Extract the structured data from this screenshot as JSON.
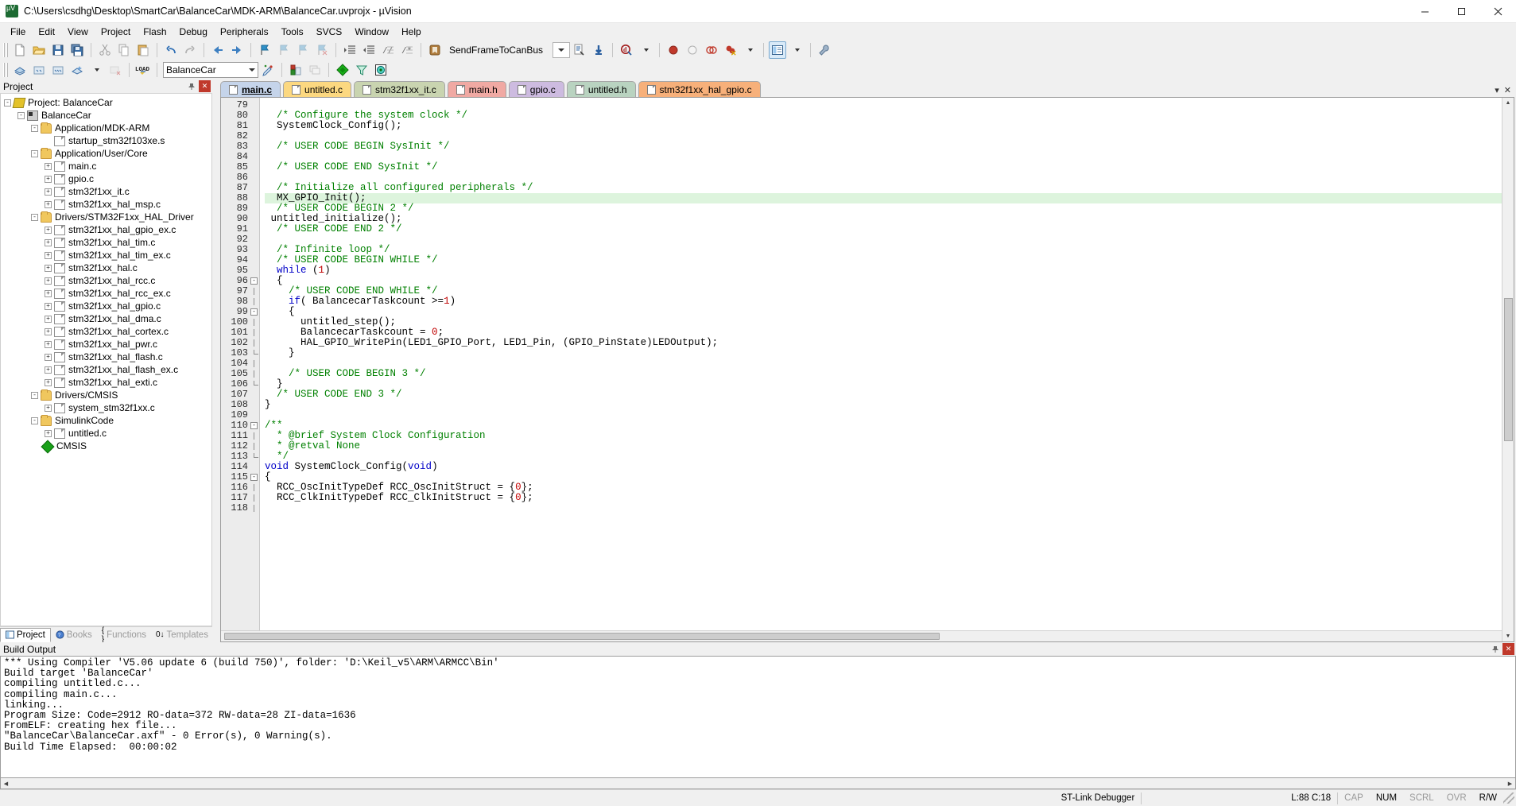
{
  "window": {
    "title": "C:\\Users\\csdhg\\Desktop\\SmartCar\\BalanceCar\\MDK-ARM\\BalanceCar.uvprojx - µVision",
    "app_icon": "uvision-icon",
    "minimize": "─",
    "maximize": "☐",
    "close": "✕"
  },
  "menu": {
    "items": [
      {
        "label": "File"
      },
      {
        "label": "Edit"
      },
      {
        "label": "View"
      },
      {
        "label": "Project"
      },
      {
        "label": "Flash"
      },
      {
        "label": "Debug"
      },
      {
        "label": "Peripherals"
      },
      {
        "label": "Tools"
      },
      {
        "label": "SVCS"
      },
      {
        "label": "Window"
      },
      {
        "label": "Help"
      }
    ]
  },
  "toolbar1": {
    "icons": [
      "new-file-icon",
      "open-file-icon",
      "save-icon",
      "save-all-icon",
      "cut-icon",
      "copy-icon",
      "paste-icon",
      "undo-icon",
      "redo-icon",
      "navigate-back-icon",
      "navigate-forward-icon",
      "bookmark-toggle-icon",
      "bookmark-prev-icon",
      "bookmark-next-icon",
      "bookmark-clear-icon",
      "indent-icon",
      "outdent-icon",
      "comment-icon",
      "uncomment-icon"
    ],
    "bookmark_label": "SendFrameToCanBus",
    "combo_icon": "chevron-down-icon",
    "insert_bookmark_icon": "insert-bookmark-icon",
    "find-in-files-icon": "find-in-files-icon",
    "debug_icon": "start-debug-icon",
    "breakpoint_icon": "insert-breakpoint-icon",
    "breakpoint_disable_icon": "disable-breakpoint-icon",
    "breakpoint_kill_all_icon": "kill-all-breakpoints-icon",
    "breakpoint_disable_all_icon": "disable-all-breakpoints-icon",
    "window_manager_icon": "manage-windows-icon",
    "configure_icon": "configure-tools-icon"
  },
  "toolbar2": {
    "icons": [
      "translate-icon",
      "build-icon",
      "rebuild-icon",
      "batch-build-icon",
      "stop-build-icon",
      "load-icon"
    ],
    "load_label": "LOAD",
    "target_label": "BalanceCar",
    "target_dropdown_icon": "chevron-down-icon",
    "options_icon": "options-for-target-icon",
    "manage_icon": "manage-project-items-icon",
    "book_icon": "books-icon",
    "component_icon": "manage-run-time-environment-icon",
    "filter_icon": "filter-icon",
    "pack_icon": "pack-installer-icon"
  },
  "project_pane": {
    "title": "Project",
    "pin_icon": "pin-icon",
    "close_icon": "close-icon",
    "tree": [
      {
        "depth": 0,
        "toggle": "-",
        "icon": "project-icon",
        "label": "Project: BalanceCar"
      },
      {
        "depth": 1,
        "toggle": "-",
        "icon": "target-icon",
        "label": "BalanceCar"
      },
      {
        "depth": 2,
        "toggle": "-",
        "icon": "folder-icon",
        "label": "Application/MDK-ARM"
      },
      {
        "depth": 3,
        "toggle": "",
        "icon": "file-icon",
        "label": "startup_stm32f103xe.s"
      },
      {
        "depth": 2,
        "toggle": "-",
        "icon": "folder-icon",
        "label": "Application/User/Core"
      },
      {
        "depth": 3,
        "toggle": "+",
        "icon": "file-icon",
        "label": "main.c"
      },
      {
        "depth": 3,
        "toggle": "+",
        "icon": "file-icon",
        "label": "gpio.c"
      },
      {
        "depth": 3,
        "toggle": "+",
        "icon": "file-icon",
        "label": "stm32f1xx_it.c"
      },
      {
        "depth": 3,
        "toggle": "+",
        "icon": "file-icon",
        "label": "stm32f1xx_hal_msp.c"
      },
      {
        "depth": 2,
        "toggle": "-",
        "icon": "folder-icon",
        "label": "Drivers/STM32F1xx_HAL_Driver"
      },
      {
        "depth": 3,
        "toggle": "+",
        "icon": "file-icon",
        "label": "stm32f1xx_hal_gpio_ex.c"
      },
      {
        "depth": 3,
        "toggle": "+",
        "icon": "file-icon",
        "label": "stm32f1xx_hal_tim.c"
      },
      {
        "depth": 3,
        "toggle": "+",
        "icon": "file-icon",
        "label": "stm32f1xx_hal_tim_ex.c"
      },
      {
        "depth": 3,
        "toggle": "+",
        "icon": "file-icon",
        "label": "stm32f1xx_hal.c"
      },
      {
        "depth": 3,
        "toggle": "+",
        "icon": "file-icon",
        "label": "stm32f1xx_hal_rcc.c"
      },
      {
        "depth": 3,
        "toggle": "+",
        "icon": "file-icon",
        "label": "stm32f1xx_hal_rcc_ex.c"
      },
      {
        "depth": 3,
        "toggle": "+",
        "icon": "file-icon",
        "label": "stm32f1xx_hal_gpio.c"
      },
      {
        "depth": 3,
        "toggle": "+",
        "icon": "file-icon",
        "label": "stm32f1xx_hal_dma.c"
      },
      {
        "depth": 3,
        "toggle": "+",
        "icon": "file-icon",
        "label": "stm32f1xx_hal_cortex.c"
      },
      {
        "depth": 3,
        "toggle": "+",
        "icon": "file-icon",
        "label": "stm32f1xx_hal_pwr.c"
      },
      {
        "depth": 3,
        "toggle": "+",
        "icon": "file-icon",
        "label": "stm32f1xx_hal_flash.c"
      },
      {
        "depth": 3,
        "toggle": "+",
        "icon": "file-icon",
        "label": "stm32f1xx_hal_flash_ex.c"
      },
      {
        "depth": 3,
        "toggle": "+",
        "icon": "file-icon",
        "label": "stm32f1xx_hal_exti.c"
      },
      {
        "depth": 2,
        "toggle": "-",
        "icon": "folder-icon",
        "label": "Drivers/CMSIS"
      },
      {
        "depth": 3,
        "toggle": "+",
        "icon": "file-icon",
        "label": "system_stm32f1xx.c"
      },
      {
        "depth": 2,
        "toggle": "-",
        "icon": "folder-icon",
        "label": "SimulinkCode"
      },
      {
        "depth": 3,
        "toggle": "+",
        "icon": "file-icon",
        "label": "untitled.c"
      },
      {
        "depth": 2,
        "toggle": "",
        "icon": "cmsis-icon",
        "label": "CMSIS"
      }
    ],
    "bottom_tabs": [
      {
        "label": "Project",
        "icon": "project-tab-icon",
        "selected": true
      },
      {
        "label": "Books",
        "icon": "books-tab-icon",
        "selected": false
      },
      {
        "label": "Functions",
        "icon": "functions-tab-icon",
        "selected": false
      },
      {
        "label": "Templates",
        "icon": "templates-tab-icon",
        "selected": false
      }
    ]
  },
  "editor": {
    "tabs": [
      {
        "label": "main.c",
        "color": "#c5d4ea",
        "selected": true
      },
      {
        "label": "untitled.c",
        "color": "#fcd880",
        "selected": false
      },
      {
        "label": "stm32f1xx_it.c",
        "color": "#c9d4b0",
        "selected": false
      },
      {
        "label": "main.h",
        "color": "#f0a9a3",
        "selected": false
      },
      {
        "label": "gpio.c",
        "color": "#cdbbe0",
        "selected": false
      },
      {
        "label": "untitled.h",
        "color": "#b9d3c0",
        "selected": false
      },
      {
        "label": "stm32f1xx_hal_gpio.c",
        "color": "#f7b07a",
        "selected": false
      }
    ],
    "tab_scroll_left_icon": "chevron-down-icon",
    "tab_close_icon": "close-icon",
    "first_line_number": 79,
    "highlight_line": 88,
    "lines": [
      {
        "n": 79,
        "fold": "",
        "tokens": [
          {
            "t": "",
            "c": "pl"
          }
        ]
      },
      {
        "n": 80,
        "fold": "",
        "tokens": [
          {
            "t": "  /* Configure the system clock */",
            "c": "cm"
          }
        ]
      },
      {
        "n": 81,
        "fold": "",
        "tokens": [
          {
            "t": "  SystemClock_Config();",
            "c": "pl"
          }
        ]
      },
      {
        "n": 82,
        "fold": "",
        "tokens": [
          {
            "t": "",
            "c": "pl"
          }
        ]
      },
      {
        "n": 83,
        "fold": "",
        "tokens": [
          {
            "t": "  /* USER CODE BEGIN SysInit */",
            "c": "cm"
          }
        ]
      },
      {
        "n": 84,
        "fold": "",
        "tokens": [
          {
            "t": "",
            "c": "pl"
          }
        ]
      },
      {
        "n": 85,
        "fold": "",
        "tokens": [
          {
            "t": "  /* USER CODE END SysInit */",
            "c": "cm"
          }
        ]
      },
      {
        "n": 86,
        "fold": "",
        "tokens": [
          {
            "t": "",
            "c": "pl"
          }
        ]
      },
      {
        "n": 87,
        "fold": "",
        "tokens": [
          {
            "t": "  /* Initialize all configured peripherals */",
            "c": "cm"
          }
        ]
      },
      {
        "n": 88,
        "fold": "",
        "tokens": [
          {
            "t": "  MX_GPIO_Init();",
            "c": "pl"
          }
        ]
      },
      {
        "n": 89,
        "fold": "",
        "tokens": [
          {
            "t": "  /* USER CODE BEGIN 2 */",
            "c": "cm"
          }
        ]
      },
      {
        "n": 90,
        "fold": "",
        "tokens": [
          {
            "t": " untitled_initialize();",
            "c": "pl"
          }
        ]
      },
      {
        "n": 91,
        "fold": "",
        "tokens": [
          {
            "t": "  /* USER CODE END 2 */",
            "c": "cm"
          }
        ]
      },
      {
        "n": 92,
        "fold": "",
        "tokens": [
          {
            "t": "",
            "c": "pl"
          }
        ]
      },
      {
        "n": 93,
        "fold": "",
        "tokens": [
          {
            "t": "  /* Infinite loop */",
            "c": "cm"
          }
        ]
      },
      {
        "n": 94,
        "fold": "",
        "tokens": [
          {
            "t": "  /* USER CODE BEGIN WHILE */",
            "c": "cm"
          }
        ]
      },
      {
        "n": 95,
        "fold": "",
        "tokens": [
          {
            "t": "  ",
            "c": "pl"
          },
          {
            "t": "while",
            "c": "kw"
          },
          {
            "t": " (",
            "c": "pl"
          },
          {
            "t": "1",
            "c": "num"
          },
          {
            "t": ")",
            "c": "pl"
          }
        ]
      },
      {
        "n": 96,
        "fold": "-",
        "tokens": [
          {
            "t": "  {",
            "c": "pl"
          }
        ]
      },
      {
        "n": 97,
        "fold": "bar",
        "tokens": [
          {
            "t": "    /* USER CODE END WHILE */",
            "c": "cm"
          }
        ]
      },
      {
        "n": 98,
        "fold": "bar",
        "tokens": [
          {
            "t": "    ",
            "c": "pl"
          },
          {
            "t": "if",
            "c": "kw"
          },
          {
            "t": "( BalancecarTaskcount >=",
            "c": "pl"
          },
          {
            "t": "1",
            "c": "num"
          },
          {
            "t": ")",
            "c": "pl"
          }
        ]
      },
      {
        "n": 99,
        "fold": "-",
        "tokens": [
          {
            "t": "    {",
            "c": "pl"
          }
        ]
      },
      {
        "n": 100,
        "fold": "bar",
        "tokens": [
          {
            "t": "      untitled_step();",
            "c": "pl"
          }
        ]
      },
      {
        "n": 101,
        "fold": "bar",
        "tokens": [
          {
            "t": "      BalancecarTaskcount = ",
            "c": "pl"
          },
          {
            "t": "0",
            "c": "num"
          },
          {
            "t": ";",
            "c": "pl"
          }
        ]
      },
      {
        "n": 102,
        "fold": "bar",
        "tokens": [
          {
            "t": "      HAL_GPIO_WritePin(LED1_GPIO_Port, LED1_Pin, (GPIO_PinState)LEDOutput);",
            "c": "pl"
          }
        ]
      },
      {
        "n": 103,
        "fold": "end",
        "tokens": [
          {
            "t": "    }",
            "c": "pl"
          }
        ]
      },
      {
        "n": 104,
        "fold": "bar",
        "tokens": [
          {
            "t": "",
            "c": "pl"
          }
        ]
      },
      {
        "n": 105,
        "fold": "bar",
        "tokens": [
          {
            "t": "    /* USER CODE BEGIN 3 */",
            "c": "cm"
          }
        ]
      },
      {
        "n": 106,
        "fold": "end",
        "tokens": [
          {
            "t": "  }",
            "c": "pl"
          }
        ]
      },
      {
        "n": 107,
        "fold": "",
        "tokens": [
          {
            "t": "  /* USER CODE END 3 */",
            "c": "cm"
          }
        ]
      },
      {
        "n": 108,
        "fold": "",
        "tokens": [
          {
            "t": "}",
            "c": "pl"
          }
        ]
      },
      {
        "n": 109,
        "fold": "",
        "tokens": [
          {
            "t": "",
            "c": "pl"
          }
        ]
      },
      {
        "n": 110,
        "fold": "-",
        "tokens": [
          {
            "t": "/**",
            "c": "cm"
          }
        ]
      },
      {
        "n": 111,
        "fold": "bar",
        "tokens": [
          {
            "t": "  * @brief System Clock Configuration",
            "c": "cm"
          }
        ]
      },
      {
        "n": 112,
        "fold": "bar",
        "tokens": [
          {
            "t": "  * @retval None",
            "c": "cm"
          }
        ]
      },
      {
        "n": 113,
        "fold": "end",
        "tokens": [
          {
            "t": "  */",
            "c": "cm"
          }
        ]
      },
      {
        "n": 114,
        "fold": "",
        "tokens": [
          {
            "t": "void",
            "c": "kw"
          },
          {
            "t": " SystemClock_Config(",
            "c": "pl"
          },
          {
            "t": "void",
            "c": "kw"
          },
          {
            "t": ")",
            "c": "pl"
          }
        ]
      },
      {
        "n": 115,
        "fold": "-",
        "tokens": [
          {
            "t": "{",
            "c": "pl"
          }
        ]
      },
      {
        "n": 116,
        "fold": "bar",
        "tokens": [
          {
            "t": "  RCC_OscInitTypeDef RCC_OscInitStruct = {",
            "c": "pl"
          },
          {
            "t": "0",
            "c": "num"
          },
          {
            "t": "};",
            "c": "pl"
          }
        ]
      },
      {
        "n": 117,
        "fold": "bar",
        "tokens": [
          {
            "t": "  RCC_ClkInitTypeDef RCC_ClkInitStruct = {",
            "c": "pl"
          },
          {
            "t": "0",
            "c": "num"
          },
          {
            "t": "};",
            "c": "pl"
          }
        ]
      },
      {
        "n": 118,
        "fold": "bar",
        "tokens": [
          {
            "t": "",
            "c": "pl"
          }
        ]
      }
    ]
  },
  "build_output": {
    "title": "Build Output",
    "pin_icon": "pin-icon",
    "close_icon": "close-icon",
    "lines": [
      "*** Using Compiler 'V5.06 update 6 (build 750)', folder: 'D:\\Keil_v5\\ARM\\ARMCC\\Bin'",
      "Build target 'BalanceCar'",
      "compiling untitled.c...",
      "compiling main.c...",
      "linking...",
      "Program Size: Code=2912 RO-data=372 RW-data=28 ZI-data=1636  ",
      "FromELF: creating hex file...",
      "\"BalanceCar\\BalanceCar.axf\" - 0 Error(s), 0 Warning(s).",
      "Build Time Elapsed:  00:00:02"
    ]
  },
  "statusbar": {
    "debugger": "ST-Link Debugger",
    "caret": "L:88 C:18",
    "caps": "CAP",
    "num": "NUM",
    "scrl": "SCRL",
    "ovr": "OVR",
    "rw": "R/W"
  }
}
